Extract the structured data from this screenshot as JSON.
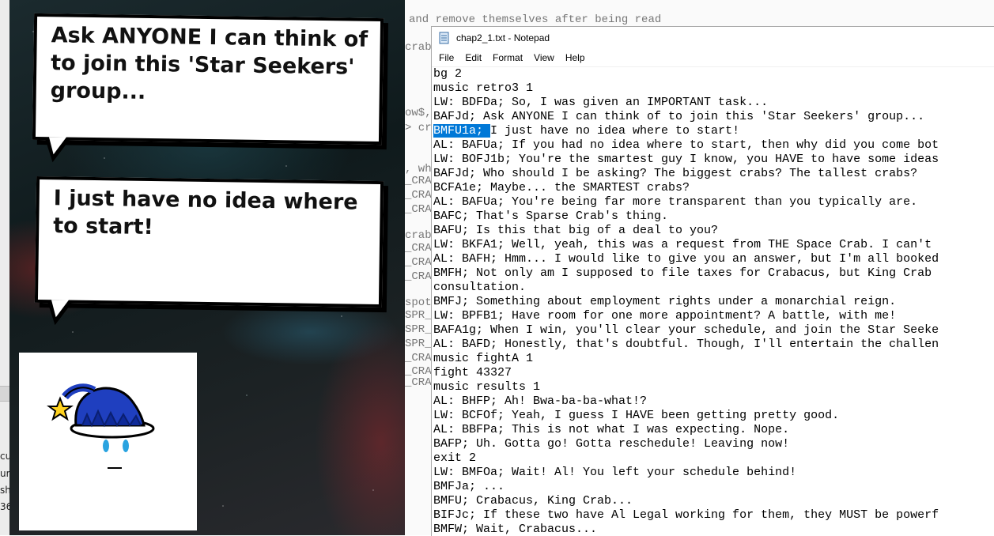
{
  "game": {
    "bubble1": {
      "text": "Ask ANYONE I can think of to join this 'Star Seekers' group..."
    },
    "bubble2": {
      "text": "I just have no idea where to start!"
    }
  },
  "left_strip": {
    "fragments": [
      "cu",
      "um",
      "sh",
      "36"
    ]
  },
  "background_terminal": {
    "lines": [
      "and remove themselves after being read",
      "crab",
      "ow$,",
      "> cr",
      ", wh",
      "_CRA",
      "_CRA",
      "_CRA",
      "crab",
      "_CRA",
      "_CRA",
      "_CRA",
      "spot",
      "SPR_",
      "SPR_",
      "SPR_",
      "_CRA",
      "_CRA",
      "_CRA"
    ]
  },
  "notepad": {
    "title": "chap2_1.txt - Notepad",
    "menu": [
      "File",
      "Edit",
      "Format",
      "View",
      "Help"
    ],
    "selected_text": "BMFU1a;",
    "lines": [
      "bg 2",
      "music retro3 1",
      "LW: BDFDa; So, I was given an IMPORTANT task...",
      "BAFJd; Ask ANYONE I can think of to join this 'Star Seekers' group...",
      "BMFU1a; I just have no idea where to start!",
      "AL: BAFUa; If you had no idea where to start, then why did you come bot",
      "LW: BOFJ1b; You're the smartest guy I know, you HAVE to have some ideas",
      "BAFJd; Who should I be asking? The biggest crabs? The tallest crabs?",
      "BCFA1e; Maybe... the SMARTEST crabs?",
      "AL: BAFUa; You're being far more transparent than you typically are.",
      "BAFC; That's Sparse Crab's thing.",
      "BAFU; Is this that big of a deal to you?",
      "LW: BKFA1; Well, yeah, this was a request from THE Space Crab. I can't",
      "AL: BAFH; Hmm... I would like to give you an answer, but I'm all booked",
      "BMFH; Not only am I supposed to file taxes for Crabacus, but King Crab",
      "consultation.",
      "BMFJ; Something about employment rights under a monarchial reign.",
      "LW: BPFB1; Have room for one more appointment? A battle, with me!",
      "BAFA1g; When I win, you'll clear your schedule, and join the Star Seeke",
      "AL: BAFD; Honestly, that's doubtful. Though, I'll entertain the challen",
      "music fightA 1",
      "fight 43327",
      "music results 1",
      "AL: BHFP; Ah! Bwa-ba-ba-what!?",
      "LW: BCFOf; Yeah, I guess I HAVE been getting pretty good.",
      "AL: BBFPa; This is not what I was expecting. Nope.",
      "BAFP; Uh. Gotta go! Gotta reschedule! Leaving now!",
      "exit 2",
      "LW: BMFOa; Wait! Al! You left your schedule behind!",
      "BMFJa; ...",
      "BMFU; Crabacus, King Crab...",
      "BIFJc; If these two have Al Legal working for them, they MUST be powerf",
      "BMFW; Wait, Crabacus..."
    ]
  }
}
